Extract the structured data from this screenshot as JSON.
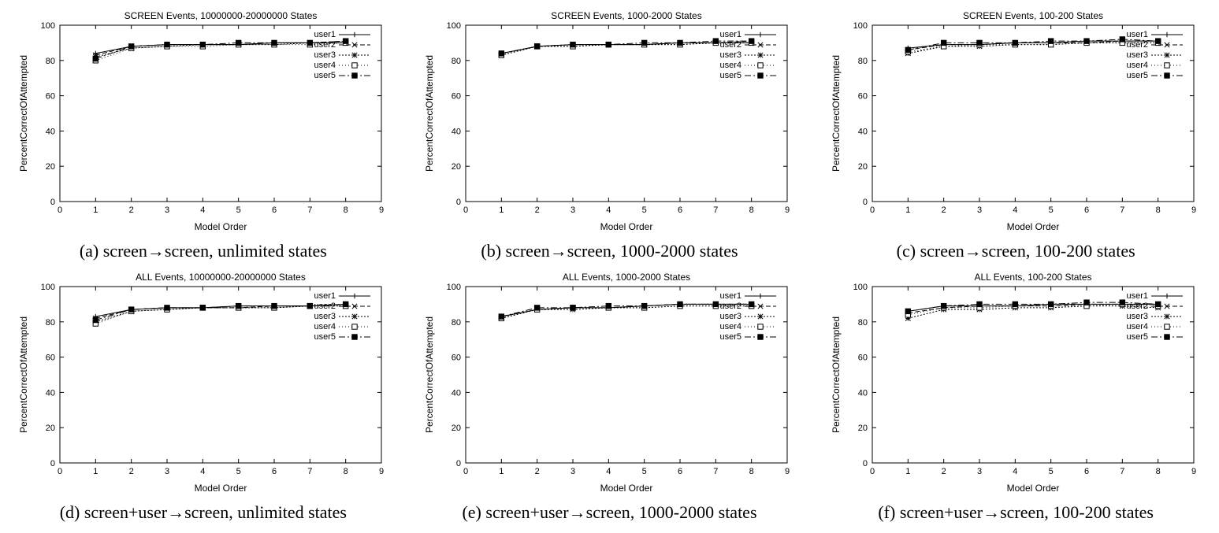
{
  "layout": {
    "cols": 3,
    "rows": 2
  },
  "common": {
    "xlabel": "Model Order",
    "ylabel": "PercentCorrectOfAttempted",
    "xlim": [
      0,
      9
    ],
    "ylim": [
      0,
      100
    ],
    "xticks": [
      0,
      1,
      2,
      3,
      4,
      5,
      6,
      7,
      8,
      9
    ],
    "yticks": [
      0,
      20,
      40,
      60,
      80,
      100
    ],
    "legend": [
      "user1",
      "user2",
      "user3",
      "user4",
      "user5"
    ]
  },
  "chart_data": [
    {
      "id": "a",
      "title": "SCREEN Events, 10000000-20000000 States",
      "caption": "(a) screen→screen, unlimited states",
      "type": "line",
      "x": [
        1,
        2,
        3,
        4,
        5,
        6,
        7,
        8
      ],
      "series": [
        {
          "name": "user1",
          "values": [
            84,
            88,
            89,
            89,
            89,
            90,
            90,
            90
          ]
        },
        {
          "name": "user2",
          "values": [
            83,
            88,
            89,
            89,
            89,
            90,
            90,
            91
          ]
        },
        {
          "name": "user3",
          "values": [
            82,
            87,
            88,
            89,
            89,
            89,
            90,
            90
          ]
        },
        {
          "name": "user4",
          "values": [
            80,
            87,
            88,
            88,
            89,
            89,
            89,
            90
          ]
        },
        {
          "name": "user5",
          "values": [
            81,
            88,
            89,
            89,
            90,
            90,
            90,
            91
          ]
        }
      ]
    },
    {
      "id": "b",
      "title": "SCREEN Events, 1000-2000 States",
      "caption": "(b) screen→screen, 1000-2000 states",
      "type": "line",
      "x": [
        1,
        2,
        3,
        4,
        5,
        6,
        7,
        8
      ],
      "series": [
        {
          "name": "user1",
          "values": [
            84,
            88,
            89,
            89,
            89,
            90,
            90,
            90
          ]
        },
        {
          "name": "user2",
          "values": [
            84,
            88,
            89,
            89,
            89,
            90,
            90,
            91
          ]
        },
        {
          "name": "user3",
          "values": [
            83,
            88,
            88,
            89,
            89,
            89,
            90,
            90
          ]
        },
        {
          "name": "user4",
          "values": [
            83,
            88,
            88,
            89,
            89,
            89,
            90,
            90
          ]
        },
        {
          "name": "user5",
          "values": [
            84,
            88,
            89,
            89,
            90,
            90,
            91,
            91
          ]
        }
      ]
    },
    {
      "id": "c",
      "title": "SCREEN Events, 100-200 States",
      "caption": "(c) screen→screen, 100-200 states",
      "type": "line",
      "x": [
        1,
        2,
        3,
        4,
        5,
        6,
        7,
        8
      ],
      "series": [
        {
          "name": "user1",
          "values": [
            87,
            89,
            89,
            90,
            90,
            91,
            91,
            91
          ]
        },
        {
          "name": "user2",
          "values": [
            86,
            89,
            89,
            90,
            90,
            90,
            91,
            91
          ]
        },
        {
          "name": "user3",
          "values": [
            84,
            88,
            88,
            89,
            89,
            90,
            90,
            90
          ]
        },
        {
          "name": "user4",
          "values": [
            85,
            88,
            89,
            89,
            89,
            90,
            90,
            90
          ]
        },
        {
          "name": "user5",
          "values": [
            86,
            90,
            90,
            90,
            91,
            91,
            92,
            91
          ]
        }
      ]
    },
    {
      "id": "d",
      "title": "ALL Events, 10000000-20000000 States",
      "caption": "(d) screen+user→screen, unlimited states",
      "type": "line",
      "x": [
        1,
        2,
        3,
        4,
        5,
        6,
        7,
        8
      ],
      "series": [
        {
          "name": "user1",
          "values": [
            83,
            87,
            88,
            88,
            89,
            89,
            89,
            90
          ]
        },
        {
          "name": "user2",
          "values": [
            82,
            87,
            88,
            88,
            88,
            89,
            89,
            90
          ]
        },
        {
          "name": "user3",
          "values": [
            80,
            86,
            87,
            88,
            88,
            88,
            89,
            89
          ]
        },
        {
          "name": "user4",
          "values": [
            79,
            86,
            87,
            88,
            88,
            88,
            89,
            89
          ]
        },
        {
          "name": "user5",
          "values": [
            81,
            87,
            88,
            88,
            89,
            89,
            89,
            90
          ]
        }
      ]
    },
    {
      "id": "e",
      "title": "ALL Events, 1000-2000 States",
      "caption": "(e) screen+user→screen, 1000-2000 states",
      "type": "line",
      "x": [
        1,
        2,
        3,
        4,
        5,
        6,
        7,
        8
      ],
      "series": [
        {
          "name": "user1",
          "values": [
            83,
            87,
            88,
            88,
            89,
            90,
            90,
            90
          ]
        },
        {
          "name": "user2",
          "values": [
            83,
            87,
            88,
            88,
            89,
            90,
            90,
            90
          ]
        },
        {
          "name": "user3",
          "values": [
            82,
            87,
            87,
            88,
            88,
            89,
            89,
            89
          ]
        },
        {
          "name": "user4",
          "values": [
            82,
            87,
            88,
            88,
            88,
            89,
            89,
            89
          ]
        },
        {
          "name": "user5",
          "values": [
            83,
            88,
            88,
            89,
            89,
            90,
            90,
            90
          ]
        }
      ]
    },
    {
      "id": "f",
      "title": "ALL Events, 100-200 States",
      "caption": "(f) screen+user→screen, 100-200 states",
      "type": "line",
      "x": [
        1,
        2,
        3,
        4,
        5,
        6,
        7,
        8
      ],
      "series": [
        {
          "name": "user1",
          "values": [
            86,
            89,
            89,
            89,
            90,
            90,
            90,
            90
          ]
        },
        {
          "name": "user2",
          "values": [
            85,
            88,
            89,
            89,
            89,
            90,
            90,
            90
          ]
        },
        {
          "name": "user3",
          "values": [
            82,
            87,
            87,
            88,
            88,
            89,
            89,
            88
          ]
        },
        {
          "name": "user4",
          "values": [
            84,
            88,
            88,
            89,
            89,
            89,
            90,
            89
          ]
        },
        {
          "name": "user5",
          "values": [
            86,
            89,
            90,
            90,
            90,
            91,
            91,
            90
          ]
        }
      ]
    }
  ]
}
